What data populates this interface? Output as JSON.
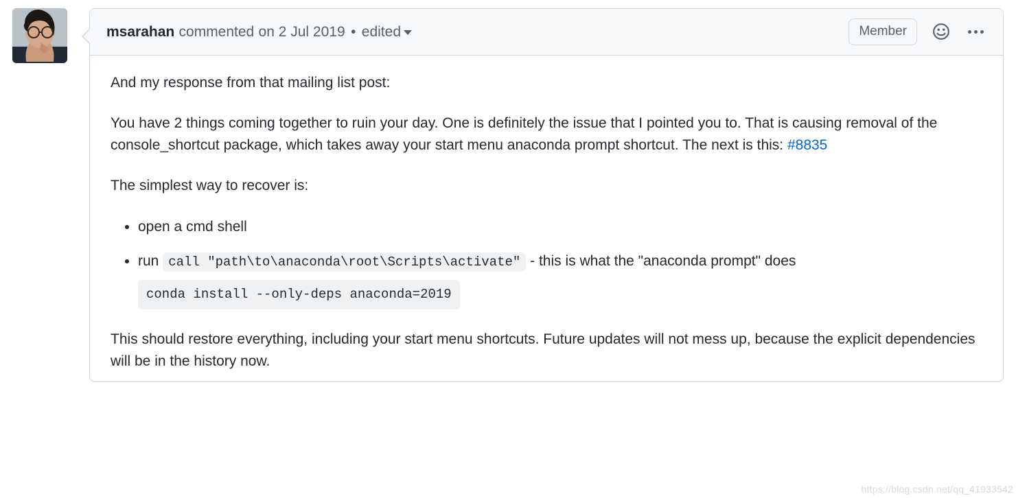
{
  "comment": {
    "author": "msarahan",
    "action_prefix": "commented",
    "timestamp": "on 2 Jul 2019",
    "separator": "•",
    "edited_label": "edited",
    "badge": "Member"
  },
  "body": {
    "p1": "And my response from that mailing list post:",
    "p2_pre": "You have 2 things coming together to ruin your day. One is definitely the issue that I pointed you to. That is causing removal of the console_shortcut package, which takes away your start menu anaconda prompt shortcut. The next is this: ",
    "issue_ref": "#8835",
    "p3": "The simplest way to recover is:",
    "steps": {
      "s1": "open a cmd shell",
      "s2_pre": "run ",
      "s2_code": "call \"path\\to\\anaconda\\root\\Scripts\\activate\"",
      "s2_post": " - this is what the \"anaconda prompt\" does",
      "s2_block": "conda install --only-deps anaconda=2019"
    },
    "p4": "This should restore everything, including your start menu shortcuts. Future updates will not mess up, because the explicit dependencies will be in the history now."
  },
  "watermark": "https://blog.csdn.net/qq_41933542"
}
